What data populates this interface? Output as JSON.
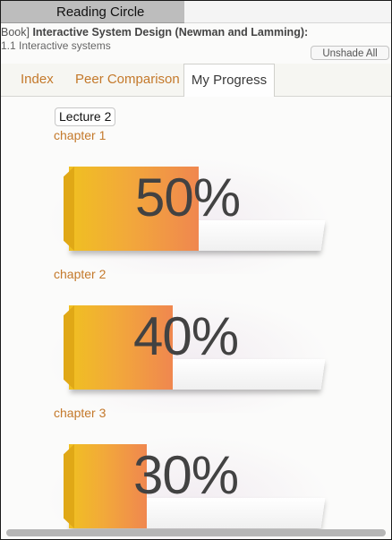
{
  "app": {
    "title": "Reading Circle"
  },
  "book": {
    "prefix": "Book] ",
    "title": "Interactive System Design (Newman and Lamming)",
    "suffix": ":",
    "section": "1.1 Interactive systems",
    "unshade_label": "Unshade All"
  },
  "tabs": [
    {
      "label": "Index",
      "active": false
    },
    {
      "label": "Peer Comparison",
      "active": false
    },
    {
      "label": "My Progress",
      "active": true
    }
  ],
  "lecture": {
    "label": "Lecture 2"
  },
  "chapters": [
    {
      "label": "chapter 1",
      "percent": 50,
      "percent_label": "50%"
    },
    {
      "label": "chapter 2",
      "percent": 40,
      "percent_label": "40%"
    },
    {
      "label": "chapter 3",
      "percent": 30,
      "percent_label": "30%"
    }
  ],
  "colors": {
    "accent": "#c4792b",
    "bar_start": "#f0c021",
    "bar_end": "#f0874f"
  }
}
